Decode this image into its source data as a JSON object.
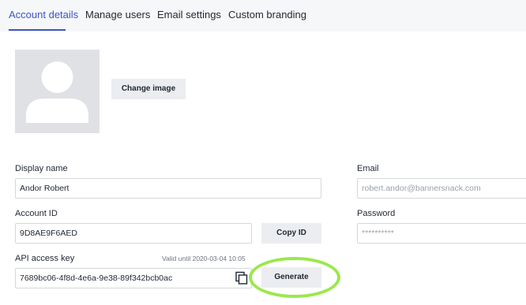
{
  "tabs": [
    {
      "label": "Account details",
      "active": true
    },
    {
      "label": "Manage users",
      "active": false
    },
    {
      "label": "Email settings",
      "active": false
    },
    {
      "label": "Custom branding",
      "active": false
    }
  ],
  "profile": {
    "change_image_label": "Change image"
  },
  "form": {
    "display_name": {
      "label": "Display name",
      "value": "Andor Robert"
    },
    "email": {
      "label": "Email",
      "value": "robert.andor@bannersnack.com"
    },
    "account_id": {
      "label": "Account ID",
      "value": "9D8AE9F6AED",
      "copy_label": "Copy ID"
    },
    "password": {
      "label": "Password",
      "value": "**********"
    },
    "api_key": {
      "label": "API access key",
      "valid_until": "Valid until 2020-03-04 10:05",
      "value": "7689bc06-4f8d-4e6a-9e38-89f342bcb0ac",
      "generate_label": "Generate"
    }
  },
  "colors": {
    "accent": "#3d56c8",
    "highlight_ring": "#9be84c"
  },
  "icons": {
    "avatar": "user-silhouette-icon",
    "copy": "copy-icon"
  }
}
